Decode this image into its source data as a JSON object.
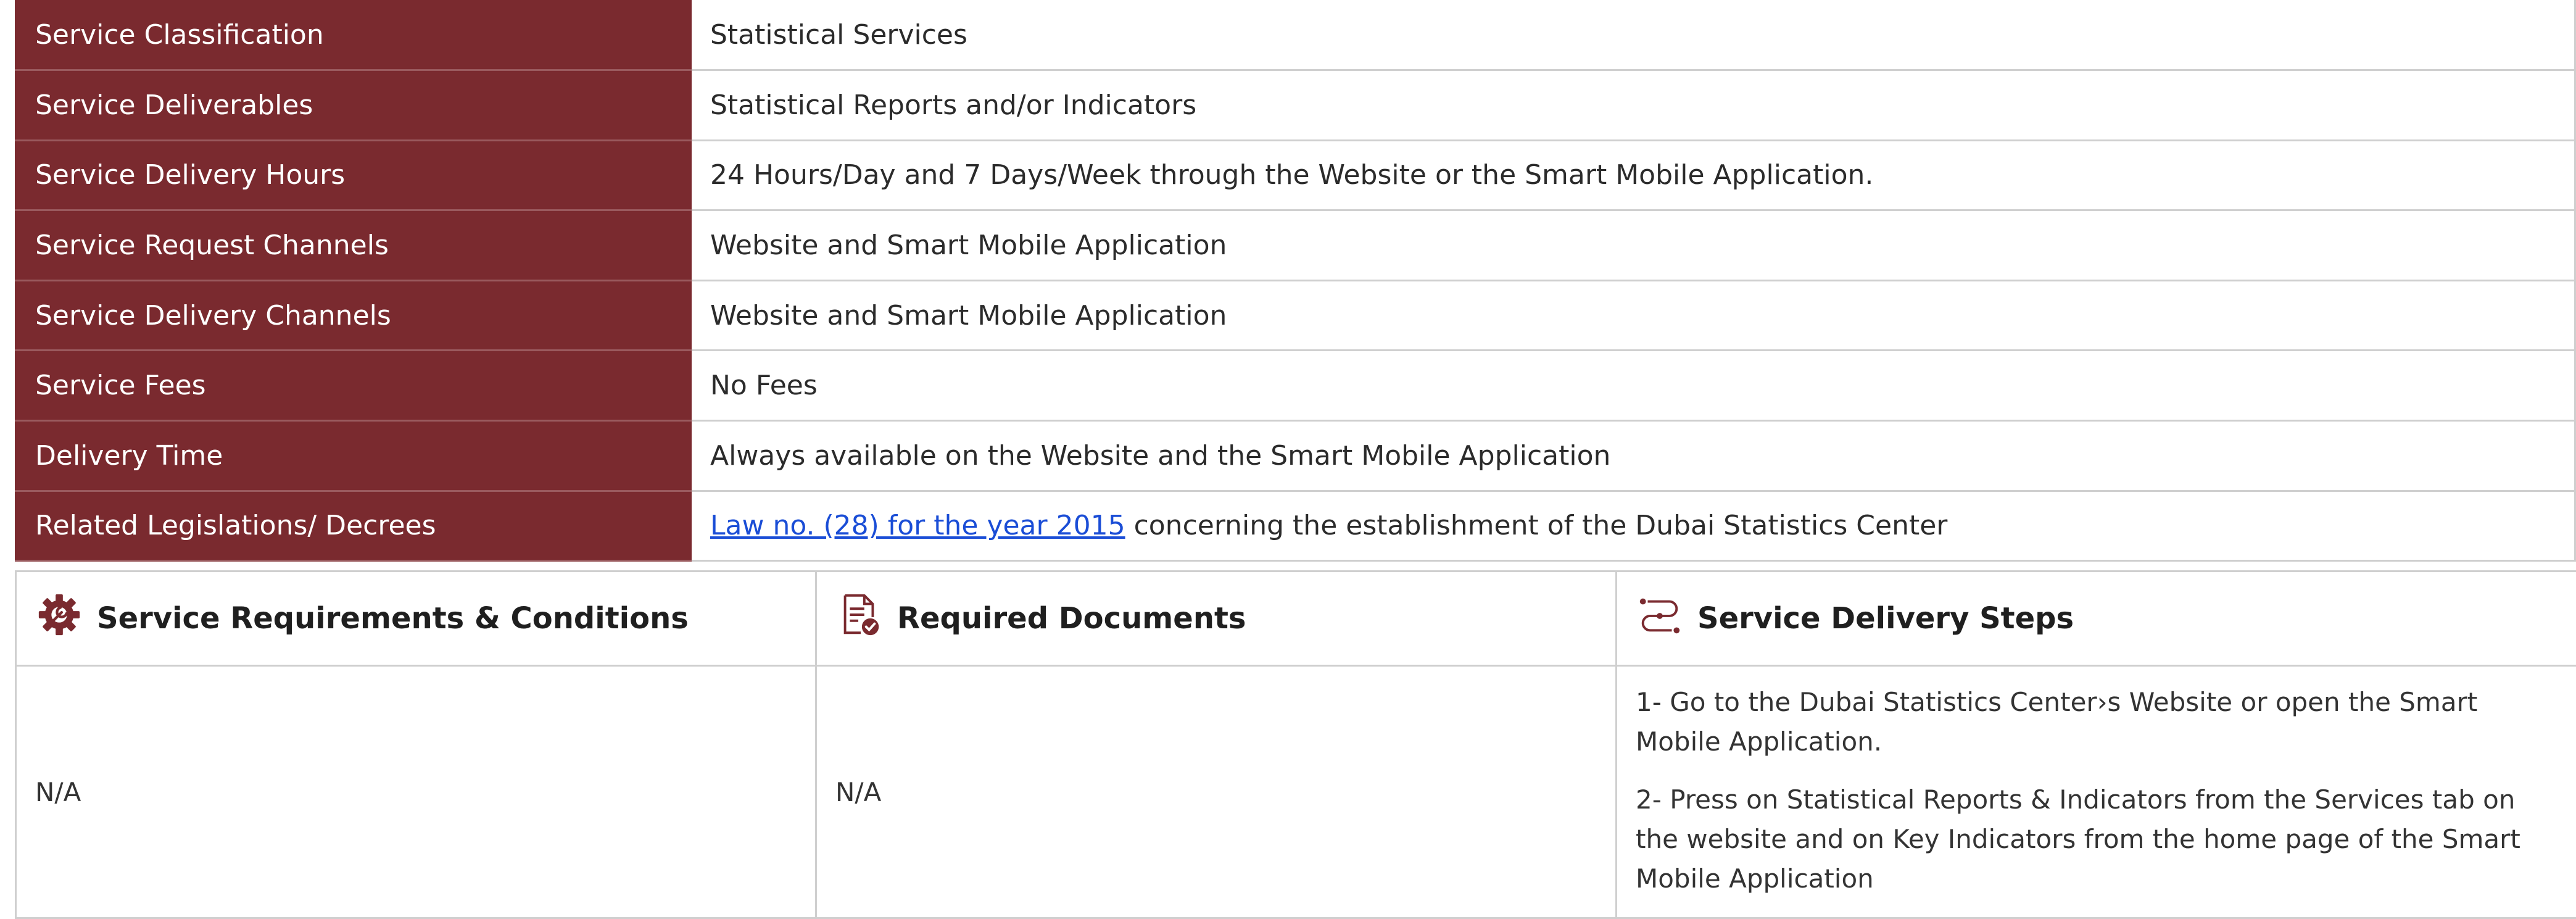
{
  "details": [
    {
      "label": "Service Classification",
      "value": "Statistical Services"
    },
    {
      "label": "Service Deliverables",
      "value": "Statistical Reports and/or Indicators"
    },
    {
      "label": "Service Delivery Hours",
      "value": "24 Hours/Day and 7 Days/Week through the Website or the Smart Mobile Application."
    },
    {
      "label": "Service Request Channels",
      "value": "Website and Smart Mobile Application"
    },
    {
      "label": "Service Delivery Channels",
      "value": "Website and Smart Mobile Application"
    },
    {
      "label": "Service Fees",
      "value": "No Fees"
    },
    {
      "label": "Delivery Time",
      "value": "Always available on the Website and the Smart Mobile Application"
    },
    {
      "label": "Related Legislations/ Decrees",
      "link_text": "Law no. (28) for the year 2015",
      "value": " concerning the establishment of the Dubai Statistics Center"
    }
  ],
  "sections": {
    "requirements": {
      "title": "Service Requirements & Conditions",
      "icon": "gear-icon",
      "content": "N/A"
    },
    "documents": {
      "title": "Required Documents",
      "icon": "document-check-icon",
      "content": "N/A"
    },
    "steps": {
      "title": "Service Delivery Steps",
      "icon": "route-steps-icon",
      "items": [
        "1- Go to the Dubai Statistics Center›s Website or open the Smart Mobile Application.",
        "2- Press on Statistical Reports & Indicators from the Services tab on the website and on Key Indicators from the home page of the Smart Mobile Application"
      ]
    }
  },
  "colors": {
    "label_bg": "#7a2a2f",
    "icon": "#7a2a2f",
    "link": "#1a4dd6",
    "border": "#cfcfcf"
  }
}
